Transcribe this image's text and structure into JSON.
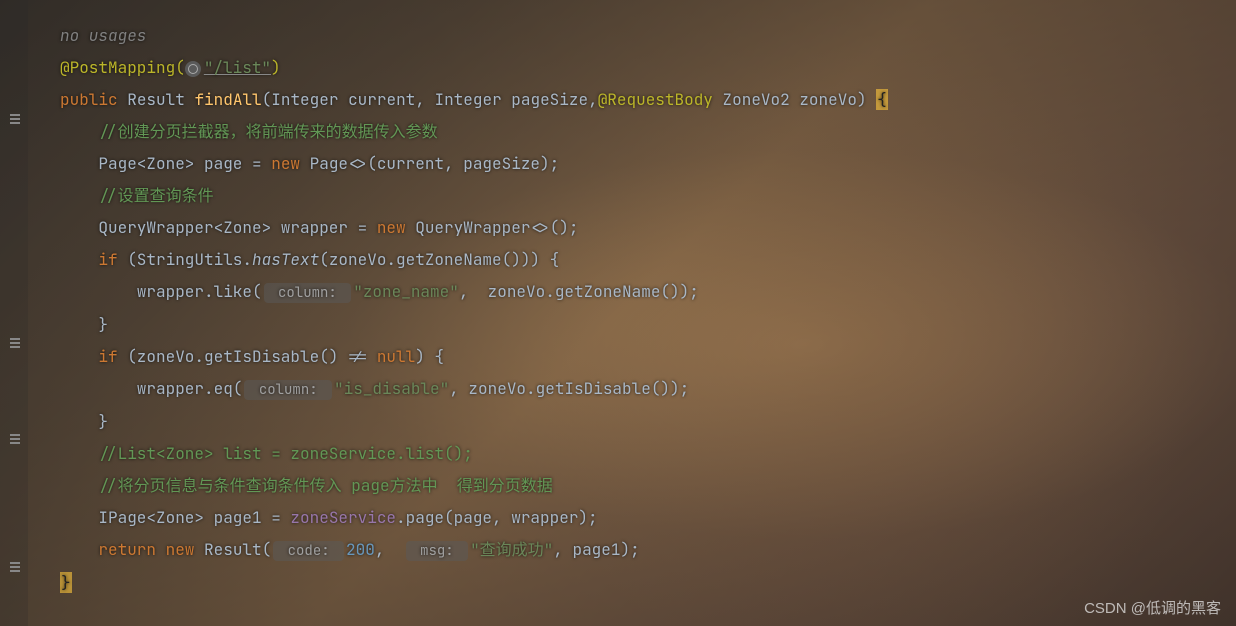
{
  "usages": "no usages",
  "annotation": {
    "name": "@PostMapping",
    "url": "\"/list\""
  },
  "method": {
    "modifier": "public",
    "returnType": "Result",
    "name": "findAll",
    "params": {
      "p1type": "Integer",
      "p1name": "current",
      "p2type": "Integer",
      "p2name": "pageSize",
      "p3anno": "@RequestBody",
      "p3type": "ZoneVo2",
      "p3name": "zoneVo"
    }
  },
  "comments": {
    "c1": "//创建分页拦截器，将前端传来的数据传入参数",
    "c2": "//设置查询条件",
    "c3": "//List<Zone> list = zoneService.list();",
    "c4": "//将分页信息与条件查询条件传入 page方法中  得到分页数据"
  },
  "lines": {
    "l1a": "Page<Zone> page = ",
    "l1b": "new",
    "l1c": " Page<>(current, pageSize);",
    "l2a": "QueryWrapper<Zone> wrapper = ",
    "l2b": "new",
    "l2c": " QueryWrapper<>();",
    "l3a": "if",
    "l3b": " (StringUtils.",
    "l3c": "hasText",
    "l3d": "(zoneVo.getZoneName())) {",
    "l4a": "    wrapper.like(",
    "l4hint": " column: ",
    "l4b": "\"zone_name\"",
    "l4c": ",  zoneVo.getZoneName());",
    "l5": "}",
    "l6a": "if",
    "l6b": " (zoneVo.getIsDisable() != ",
    "l6c": "null",
    "l6d": ") {",
    "l7a": "    wrapper.eq(",
    "l7hint": " column: ",
    "l7b": "\"is_disable\"",
    "l7c": ", zoneVo.getIsDisable());",
    "l8": "}",
    "l9a": "IPage<Zone> page1 = ",
    "l9b": "zoneService",
    "l9c": ".page(page, wrapper);",
    "l10a": "return new",
    "l10b": " Result(",
    "l10hint1": " code: ",
    "l10c": "200",
    "l10d": ",  ",
    "l10hint2": " msg: ",
    "l10e": "\"查询成功\"",
    "l10f": ", page1);",
    "close": "}"
  },
  "watermark": "CSDN @低调的黑客"
}
